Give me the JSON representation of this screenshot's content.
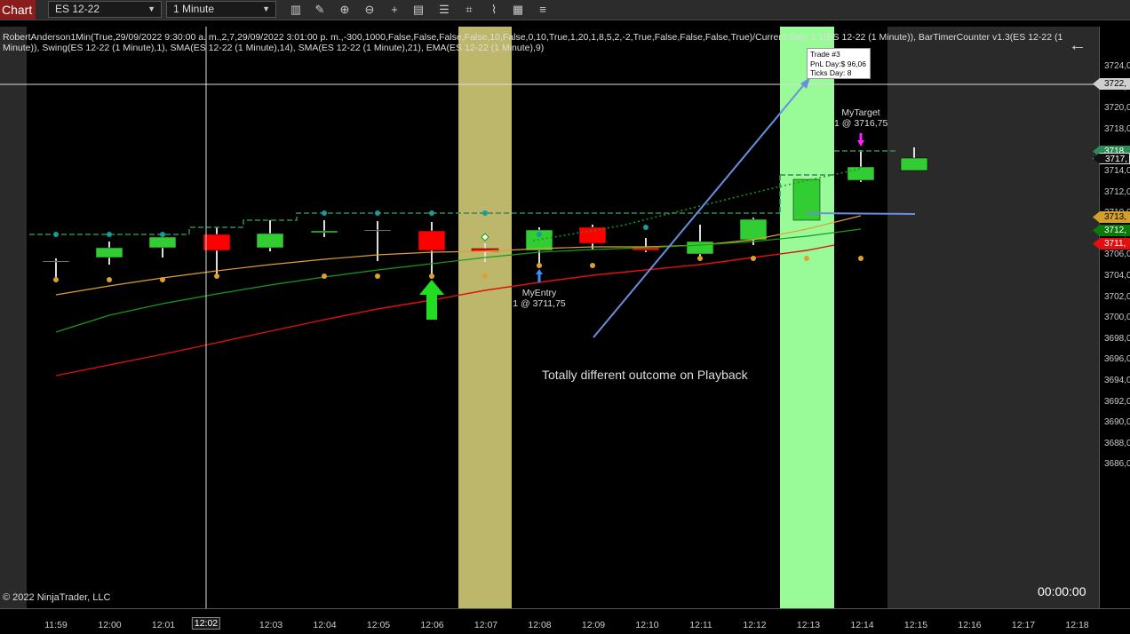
{
  "toolbar": {
    "chart_tab": "Chart",
    "instrument": "ES 12-22",
    "interval": "1 Minute"
  },
  "indicator_text": "RobertAnderson1Min(True,29/09/2022 9:30:00 a. m.,2,7,29/09/2022 3:01:00 p. m.,-300,1000,False,False,False,False,10,False,0,10,True,1,20,1,8,5,2,-2,True,False,False,False,True)/Current Day: 1 1(ES 12-22 (1 Minute)), BarTimerCounter v1.3(ES 12-22 (1 Minute)), Swing(ES 12-22 (1 Minute),1), SMA(ES 12-22 (1 Minute),14), SMA(ES 12-22 (1 Minute),21), EMA(ES 12-22 (1 Minute),9)",
  "copyright": "© 2022 NinjaTrader, LLC",
  "timer": "00:00:00",
  "annotation": "Totally different outcome on Playback",
  "trade_box": {
    "line1": "Trade #3",
    "line2": "PnL Day:$ 96,06",
    "line3": "Ticks Day: 8"
  },
  "entry": {
    "name": "MyEntry",
    "detail": "1 @ 3711,75"
  },
  "target": {
    "name": "MyTarget",
    "detail": "1 @ 3716,75"
  },
  "y_ticks": [
    "3724,00",
    "3722,00",
    "3720,00",
    "3718,00",
    "3716,00",
    "3714,00",
    "3712,00",
    "3710,00",
    "3708,00",
    "3706,00",
    "3704,00",
    "3702,00",
    "3700,00",
    "3698,00",
    "3696,00",
    "3694,00",
    "3692,00",
    "3690,00",
    "3688,00",
    "3686,00"
  ],
  "x_ticks": [
    "11:59",
    "12:00",
    "12:01",
    "12:02",
    "12:03",
    "12:04",
    "12:05",
    "12:06",
    "12:07",
    "12:08",
    "12:09",
    "12:10",
    "12:11",
    "12:12",
    "12:13",
    "12:14",
    "12:15",
    "12:16",
    "12:17",
    "12:18"
  ],
  "crosshair_time": "12:02",
  "price_tags": [
    {
      "label": "3722,",
      "color": "#cfcfcf"
    },
    {
      "label": "3718,",
      "color": "#2e8b57"
    },
    {
      "label": "3717,",
      "color": "#111111"
    },
    {
      "label": "3713,",
      "color": "#d4a02a"
    },
    {
      "label": "3712,",
      "color": "#0a7a0a"
    },
    {
      "label": "3711,",
      "color": "#e01010"
    }
  ],
  "colors": {
    "up": "#32cd32",
    "down": "#ff0000",
    "sma14": "#e0a030",
    "sma21": "#1a9a1a",
    "ema9": "#e01010"
  }
}
